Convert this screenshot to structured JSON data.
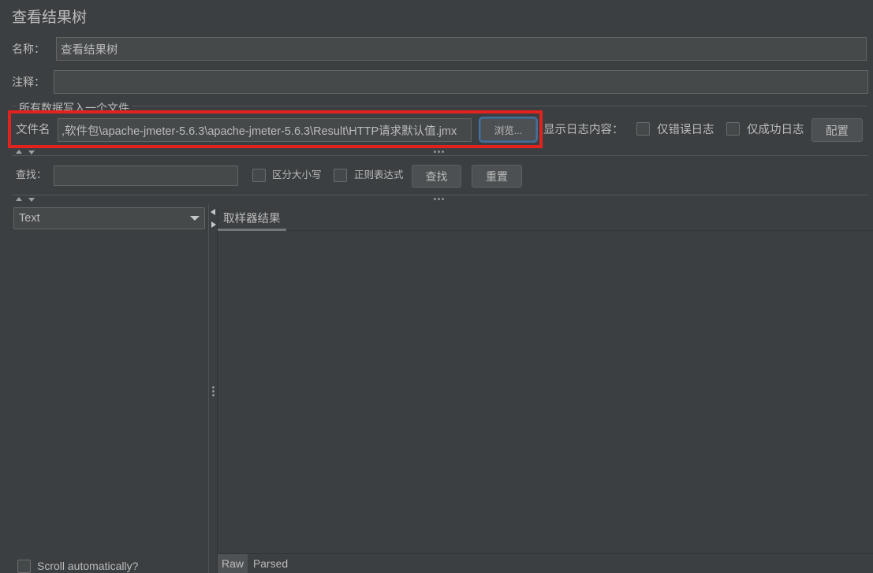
{
  "window": {
    "title": "查看结果树"
  },
  "name_field": {
    "label": "名称：",
    "value": "查看结果树"
  },
  "comment_field": {
    "label": "注释：",
    "value": ""
  },
  "file_group": {
    "title": "所有数据写入一个文件",
    "file_label": "文件名",
    "file_value": ",软件包\\apache-jmeter-5.6.3\\apache-jmeter-5.6.3\\Result\\HTTP请求默认值.jmx",
    "browse_label": "浏览...",
    "log_label": "显示日志内容：",
    "errors_only": {
      "label": "仅错误日志",
      "checked": false
    },
    "success_only": {
      "label": "仅成功日志",
      "checked": false
    },
    "configure_label": "配置"
  },
  "search": {
    "label": "查找：",
    "value": "",
    "case_sensitive": {
      "label": "区分大小写",
      "checked": false
    },
    "regex": {
      "label": "正则表达式",
      "checked": false
    },
    "find_label": "查找",
    "reset_label": "重置"
  },
  "results_tree": {
    "renderer": "Text",
    "scroll_automatically": {
      "label": "Scroll automatically?",
      "checked": false
    }
  },
  "details": {
    "tabs": [
      {
        "label": "取样器结果",
        "selected": true
      }
    ],
    "view_tabs": [
      {
        "label": "Raw",
        "selected": true
      },
      {
        "label": "Parsed",
        "selected": false
      }
    ]
  },
  "icons": {
    "renderer_dropdown": "chevron-down-icon",
    "split_collapse": "arrow-up-icon",
    "split_expand": "arrow-down-icon",
    "split_left": "arrow-left-icon",
    "split_right": "arrow-right-icon",
    "divider_grip": "grip-dots-icon"
  },
  "colors": {
    "background": "#3c3f41",
    "text": "#bbbbbb",
    "field": "#45494a",
    "highlight_box": "#e1231f",
    "focus_ring": "#4a88c7"
  }
}
